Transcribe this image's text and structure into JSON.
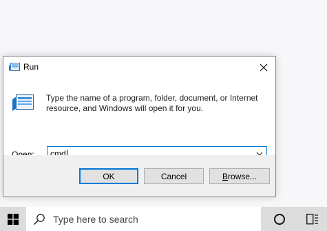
{
  "dialog": {
    "title": "Run",
    "description": "Type the name of a program, folder, document, or Internet resource, and Windows will open it for you.",
    "open_label_accel": "O",
    "open_label_rest": "pen:",
    "input_value": "cmd",
    "buttons": {
      "ok": "OK",
      "cancel": "Cancel",
      "browse_accel": "B",
      "browse_rest": "rowse..."
    }
  },
  "taskbar": {
    "search_placeholder": "Type here to search"
  },
  "icons": {
    "dialog": "run-icon",
    "close": "close-icon",
    "dropdown": "chevron-down-icon",
    "start": "windows-logo-icon",
    "search": "search-icon",
    "cortana": "cortana-circle-icon",
    "task_view": "task-view-icon"
  },
  "colors": {
    "accent": "#0078d7",
    "dialog_footer": "#f0f0f0",
    "taskbar": "#dcdcdc",
    "desktop": "#f7f7f9"
  }
}
